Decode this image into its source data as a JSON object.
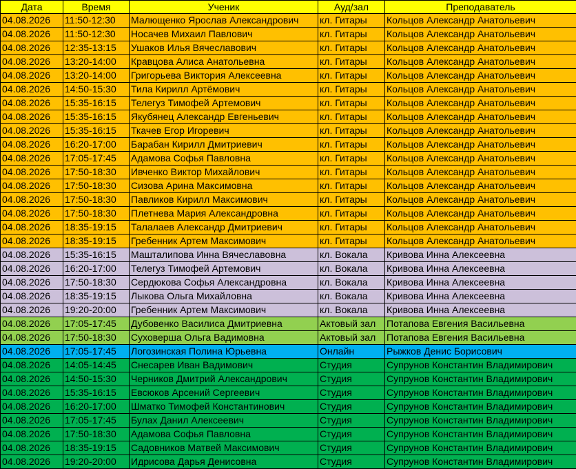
{
  "headers": [
    "Дата",
    "Время",
    "Ученик",
    "Ауд/зал",
    "Преподаватель"
  ],
  "colors": {
    "header": "#ffff00",
    "guitar": "#ffc000",
    "vocal": "#ccc0da",
    "hall": "#92d050",
    "online": "#00b0f0",
    "studio": "#00b050"
  },
  "rows": [
    {
      "date": "04.08.2026",
      "time": "11:50-12:30",
      "student": "Малющенко Ярослав Александрович",
      "room": "кл. Гитары",
      "teacher": "Кольцов Александр Анатольевич",
      "group": "guitar"
    },
    {
      "date": "04.08.2026",
      "time": "11:50-12:30",
      "student": "Носачев Михаил Павлович",
      "room": "кл. Гитары",
      "teacher": "Кольцов Александр Анатольевич",
      "group": "guitar"
    },
    {
      "date": "04.08.2026",
      "time": "12:35-13:15",
      "student": "Ушаков Илья Вячеславович",
      "room": "кл. Гитары",
      "teacher": "Кольцов Александр Анатольевич",
      "group": "guitar"
    },
    {
      "date": "04.08.2026",
      "time": "13:20-14:00",
      "student": "Кравцова Алиса Анатольевна",
      "room": "кл. Гитары",
      "teacher": "Кольцов Александр Анатольевич",
      "group": "guitar"
    },
    {
      "date": "04.08.2026",
      "time": "13:20-14:00",
      "student": "Григорьева Виктория Алексеевна",
      "room": "кл. Гитары",
      "teacher": "Кольцов Александр Анатольевич",
      "group": "guitar"
    },
    {
      "date": "04.08.2026",
      "time": "14:50-15:30",
      "student": "Тила Кирилл Артёмович",
      "room": "кл. Гитары",
      "teacher": "Кольцов Александр Анатольевич",
      "group": "guitar"
    },
    {
      "date": "04.08.2026",
      "time": "15:35-16:15",
      "student": "Телегуз Тимофей Артемович",
      "room": "кл. Гитары",
      "teacher": "Кольцов Александр Анатольевич",
      "group": "guitar"
    },
    {
      "date": "04.08.2026",
      "time": "15:35-16:15",
      "student": "Якубянец Александр Евгеньевич",
      "room": "кл. Гитары",
      "teacher": "Кольцов Александр Анатольевич",
      "group": "guitar"
    },
    {
      "date": "04.08.2026",
      "time": "15:35-16:15",
      "student": "Ткачев Егор Игоревич",
      "room": "кл. Гитары",
      "teacher": "Кольцов Александр Анатольевич",
      "group": "guitar"
    },
    {
      "date": "04.08.2026",
      "time": "16:20-17:00",
      "student": "Барабан Кирилл Дмитриевич",
      "room": "кл. Гитары",
      "teacher": "Кольцов Александр Анатольевич",
      "group": "guitar"
    },
    {
      "date": "04.08.2026",
      "time": "17:05-17:45",
      "student": "Адамова Софья Павловна",
      "room": "кл. Гитары",
      "teacher": "Кольцов Александр Анатольевич",
      "group": "guitar"
    },
    {
      "date": "04.08.2026",
      "time": "17:50-18:30",
      "student": "Ивченко Виктор Михайлович",
      "room": "кл. Гитары",
      "teacher": "Кольцов Александр Анатольевич",
      "group": "guitar"
    },
    {
      "date": "04.08.2026",
      "time": "17:50-18:30",
      "student": "Сизова  Арина Максимовна",
      "room": "кл. Гитары",
      "teacher": "Кольцов Александр Анатольевич",
      "group": "guitar"
    },
    {
      "date": "04.08.2026",
      "time": "17:50-18:30",
      "student": "Павликов Кирилл Максимович",
      "room": "кл. Гитары",
      "teacher": "Кольцов Александр Анатольевич",
      "group": "guitar"
    },
    {
      "date": "04.08.2026",
      "time": "17:50-18:30",
      "student": "Плетнева Мария Александровна",
      "room": "кл. Гитары",
      "teacher": "Кольцов Александр Анатольевич",
      "group": "guitar"
    },
    {
      "date": "04.08.2026",
      "time": "18:35-19:15",
      "student": "Талалаев Александр Дмитриевич",
      "room": "кл. Гитары",
      "teacher": "Кольцов Александр Анатольевич",
      "group": "guitar"
    },
    {
      "date": "04.08.2026",
      "time": "18:35-19:15",
      "student": "Гребенник Артем Максимович",
      "room": "кл. Гитары",
      "teacher": "Кольцов Александр Анатольевич",
      "group": "guitar"
    },
    {
      "date": "04.08.2026",
      "time": "15:35-16:15",
      "student": "Машталипова Инна Вячеславовна",
      "room": "кл. Вокала",
      "teacher": "Кривова Инна Алексеевна",
      "group": "vocal"
    },
    {
      "date": "04.08.2026",
      "time": "16:20-17:00",
      "student": "Телегуз Тимофей Артемович",
      "room": "кл. Вокала",
      "teacher": "Кривова Инна Алексеевна",
      "group": "vocal"
    },
    {
      "date": "04.08.2026",
      "time": "17:50-18:30",
      "student": "Сердюкова Софья Александровна",
      "room": "кл. Вокала",
      "teacher": "Кривова Инна Алексеевна",
      "group": "vocal"
    },
    {
      "date": "04.08.2026",
      "time": "18:35-19:15",
      "student": "Лыкова Ольга Михайловна",
      "room": "кл. Вокала",
      "teacher": "Кривова Инна Алексеевна",
      "group": "vocal"
    },
    {
      "date": "04.08.2026",
      "time": "19:20-20:00",
      "student": "Гребенник Артем Максимович",
      "room": "кл. Вокала",
      "teacher": "Кривова Инна Алексеевна",
      "group": "vocal"
    },
    {
      "date": "04.08.2026",
      "time": "17:05-17:45",
      "student": "Дубовенко Василиса Дмитриевна",
      "room": "Актовый зал",
      "teacher": "Потапова Евгения Васильевна",
      "group": "hall"
    },
    {
      "date": "04.08.2026",
      "time": "17:50-18:30",
      "student": "Суховерша Ольга Вадимовна",
      "room": "Актовый зал",
      "teacher": "Потапова Евгения Васильевна",
      "group": "hall"
    },
    {
      "date": "04.08.2026",
      "time": "17:05-17:45",
      "student": "Логозинская Полина Юрьевна",
      "room": "Онлайн",
      "teacher": "Рыжков Денис Борисович",
      "group": "online"
    },
    {
      "date": "04.08.2026",
      "time": "14:05-14:45",
      "student": "Снесарев Иван Вадимович",
      "room": "Студия",
      "teacher": "Супрунов Константин Владимирович",
      "group": "studio"
    },
    {
      "date": "04.08.2026",
      "time": "14:50-15:30",
      "student": "Черников Дмитрий Александрович",
      "room": "Студия",
      "teacher": "Супрунов Константин Владимирович",
      "group": "studio"
    },
    {
      "date": "04.08.2026",
      "time": "15:35-16:15",
      "student": "Евсюков Арсений Сергеевич",
      "room": "Студия",
      "teacher": "Супрунов Константин Владимирович",
      "group": "studio"
    },
    {
      "date": "04.08.2026",
      "time": "16:20-17:00",
      "student": "Шматко Тимофей Константинович",
      "room": "Студия",
      "teacher": "Супрунов Константин Владимирович",
      "group": "studio"
    },
    {
      "date": "04.08.2026",
      "time": "17:05-17:45",
      "student": "Булах Данил Алексеевич",
      "room": "Студия",
      "teacher": "Супрунов Константин Владимирович",
      "group": "studio"
    },
    {
      "date": "04.08.2026",
      "time": "17:50-18:30",
      "student": "Адамова Софья Павловна",
      "room": "Студия",
      "teacher": "Супрунов Константин Владимирович",
      "group": "studio"
    },
    {
      "date": "04.08.2026",
      "time": "18:35-19:15",
      "student": "Садовников Матвей Максимович",
      "room": "Студия",
      "teacher": "Супрунов Константин Владимирович",
      "group": "studio"
    },
    {
      "date": "04.08.2026",
      "time": "19:20-20:00",
      "student": "Идрисова Дарья Денисовна",
      "room": "Студия",
      "teacher": "Супрунов Константин Владимирович",
      "group": "studio"
    }
  ]
}
